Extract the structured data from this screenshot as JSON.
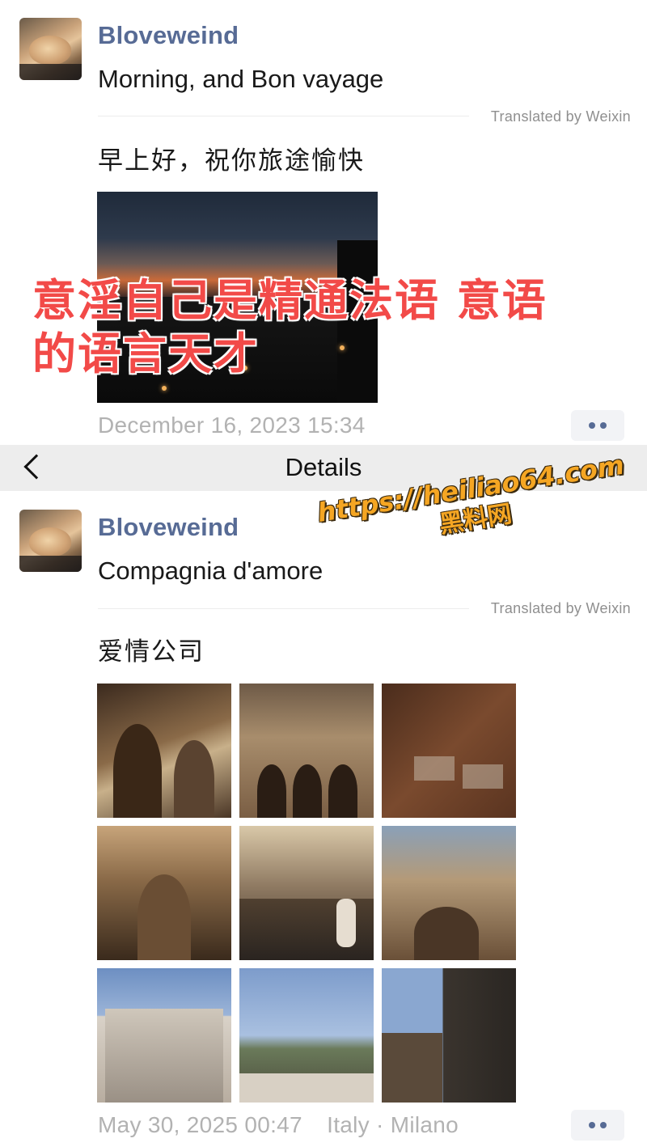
{
  "navbar": {
    "title": "Details",
    "back_icon": "chevron-left-icon"
  },
  "post1": {
    "username": "Bloveweind",
    "text": "Morning, and Bon vayage",
    "translated_by": "Translated by Weixin",
    "translation": "早上好，祝你旅途愉快",
    "timestamp": "December 16, 2023 15:34",
    "overlay_caption_line1": "意淫自己是精通法语 意语",
    "overlay_caption_line2": "的语言天才"
  },
  "post2": {
    "username": "Bloveweind",
    "text": "Compagnia d'amore",
    "translated_by": "Translated by Weixin",
    "translation": "爱情公司",
    "timestamp": "May 30, 2025 00:47",
    "location": "Italy · Milano",
    "photo_count": 9
  },
  "watermark": {
    "url": "https://heiliao64.com",
    "site_name": "黑料网"
  },
  "colors": {
    "username": "#576b95",
    "overlay_caption": "#f24a48",
    "watermark": "#f5a623",
    "navbar_bg": "#ededed"
  }
}
